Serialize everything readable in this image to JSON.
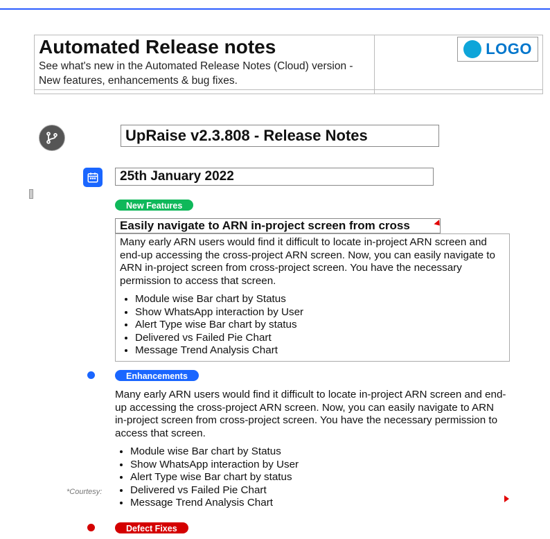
{
  "header": {
    "title": "Automated Release notes",
    "sub1": "See what's new in the Automated Release Notes (Cloud) version -",
    "sub2": "New features, enhancements & bug fixes.",
    "logo_text": "LOGO"
  },
  "version": {
    "title": "UpRaise v2.3.808 - Release Notes",
    "date": "25th January 2022"
  },
  "badges": {
    "new": "New Features",
    "enh": "Enhancements",
    "def": "Defect Fixes"
  },
  "new_feature": {
    "title": "Easily navigate to ARN in-project screen from cross",
    "body": "Many early ARN users would find it difficult to locate in-project ARN screen and end-up accessing the cross-project ARN screen. Now, you can easily navigate to ARN in-project screen from cross-project screen. You have the necessary permission to access that screen.",
    "items": [
      "Module wise Bar chart by Status",
      "Show WhatsApp interaction by User",
      "Alert Type wise Bar chart by status",
      "Delivered vs Failed Pie Chart",
      "Message Trend Analysis Chart"
    ]
  },
  "enhancements": {
    "body": "Many early ARN users would find it difficult to locate in-project ARN screen and end-up accessing the cross-project ARN screen. Now, you can easily navigate to ARN in-project screen from cross-project screen. You have the necessary permission to access that screen.",
    "items": [
      "Module wise Bar chart by Status",
      "Show WhatsApp interaction by User",
      "Alert Type wise Bar chart by status",
      "Delivered vs Failed Pie Chart",
      "Message Trend Analysis Chart"
    ]
  },
  "courtesy": "*Courtesy:"
}
